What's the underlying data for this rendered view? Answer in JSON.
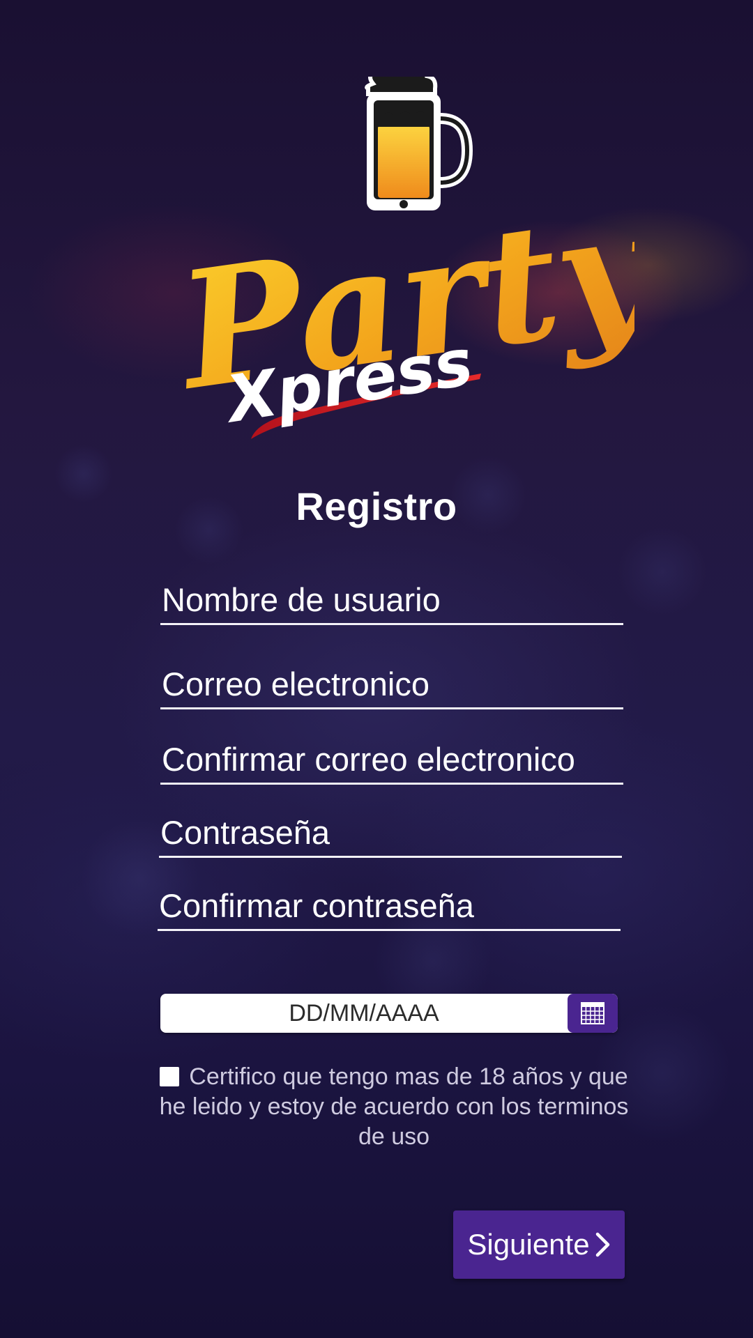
{
  "app": {
    "logo_text_main": "Party",
    "logo_text_sub": "Xpress",
    "logo_icon": "beer-mug-phone-icon"
  },
  "page": {
    "title": "Registro"
  },
  "form": {
    "username_placeholder": "Nombre de usuario",
    "email_placeholder": "Correo electronico",
    "confirm_email_placeholder": "Confirmar correo electronico",
    "password_placeholder": "Contraseña",
    "confirm_password_placeholder": "Confirmar contraseña",
    "date_placeholder": "DD/MM/AAAA",
    "calendar_icon": "calendar-icon",
    "terms_text": "Certifico que tengo mas de 18 años y que he leido y estoy de acuerdo con los terminos de uso",
    "terms_checked": false,
    "next_label": "Siguiente",
    "next_icon": "chevron-right-icon"
  },
  "colors": {
    "accent": "#4a2590",
    "logo_yellow": "#f2b31c",
    "logo_orange": "#e98a1c",
    "logo_red": "#d61f2a",
    "background": "#1a1238"
  }
}
